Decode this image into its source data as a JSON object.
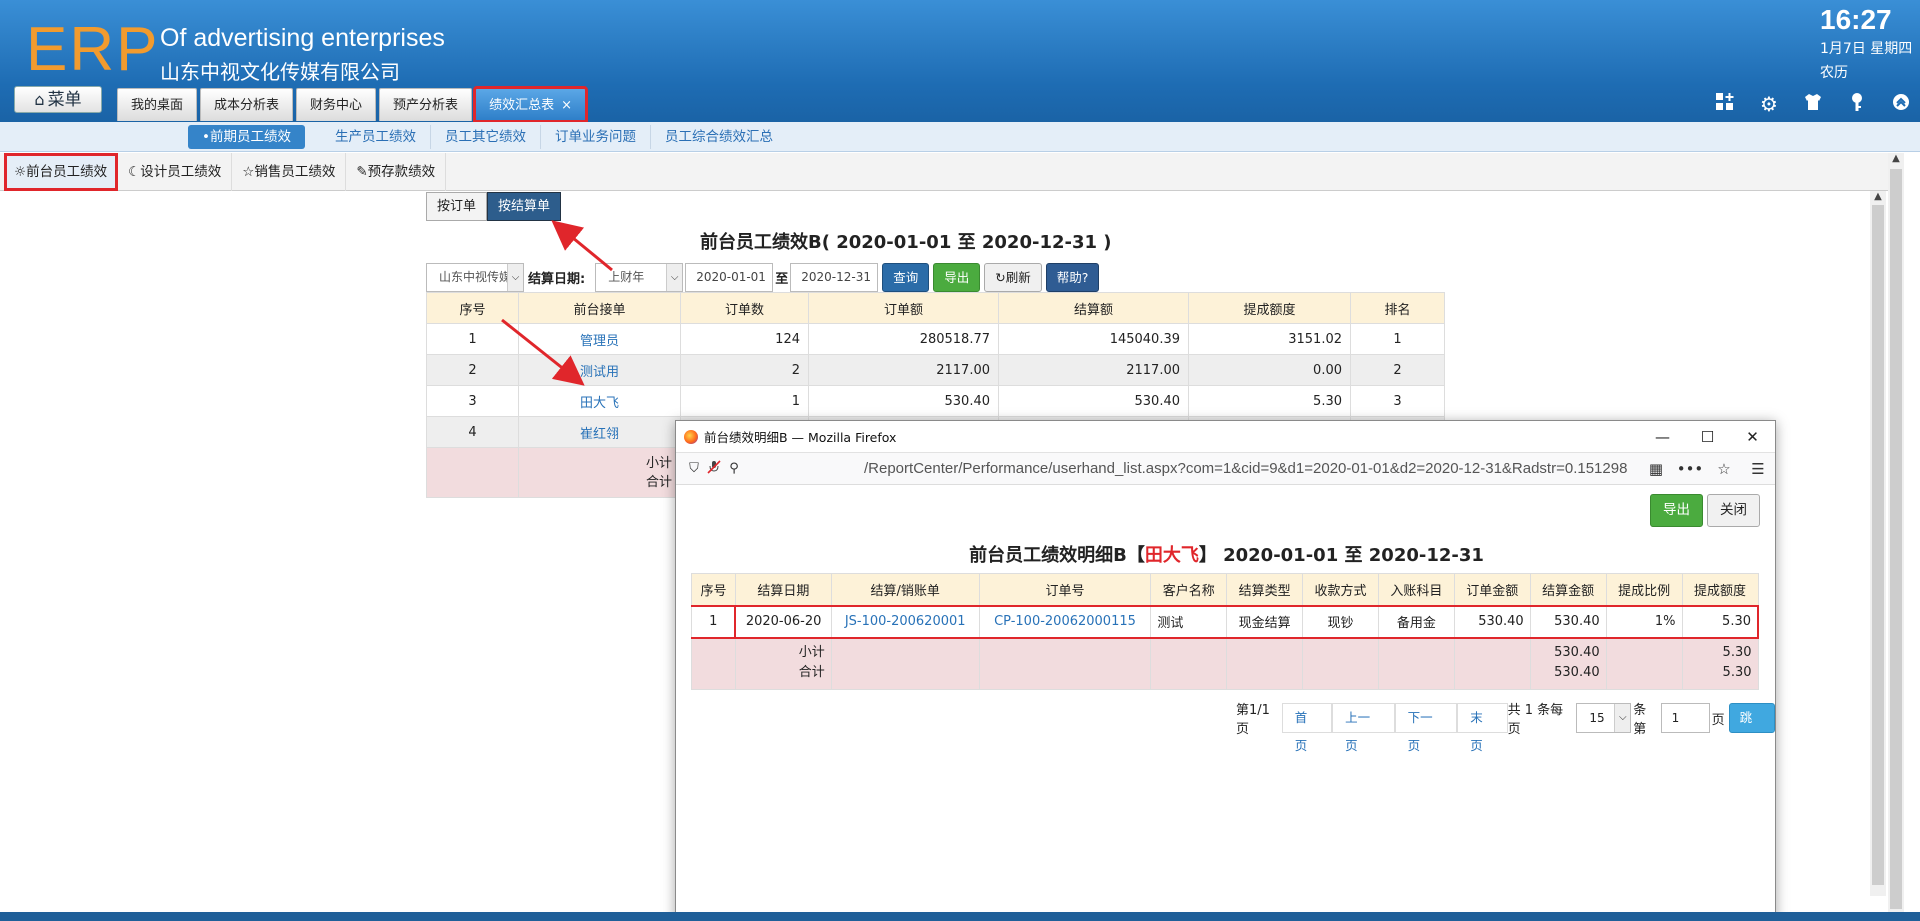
{
  "header": {
    "logo": "ERP",
    "company_en": "Of advertising enterprises",
    "company_cn": "山东中视文化传媒有限公司",
    "time": "16:27",
    "date": "1月7日 星期四",
    "lunar": "农历",
    "menu_label": "菜单",
    "tabs": [
      {
        "label": "我的桌面"
      },
      {
        "label": "成本分析表"
      },
      {
        "label": "财务中心"
      },
      {
        "label": "预产分析表"
      },
      {
        "label": "绩效汇总表",
        "close": "×"
      }
    ],
    "icons": [
      "grid-add-icon",
      "gear-icon",
      "shirt-icon",
      "key-icon",
      "chevron-up-circle-icon"
    ]
  },
  "subnav": {
    "items": [
      {
        "label": "•前期员工绩效"
      },
      {
        "label": "生产员工绩效"
      },
      {
        "label": "员工其它绩效"
      },
      {
        "label": "订单业务问题"
      },
      {
        "label": "员工综合绩效汇总"
      }
    ]
  },
  "inner_tabs": [
    {
      "icon": "☼",
      "label": "前台员工绩效"
    },
    {
      "icon": "☾",
      "label": "设计员工绩效"
    },
    {
      "icon": "☆",
      "label": "销售员工绩效"
    },
    {
      "icon": "✎",
      "label": "预存款绩效"
    }
  ],
  "mode": {
    "by_order": "按订单",
    "by_settlement": "按结算单"
  },
  "report": {
    "title": "前台员工绩效B( 2020-01-01 至 2020-12-31 )",
    "company_select": "山东中视传媒",
    "settle_label": "结算日期:",
    "period_select": "上财年",
    "date_from": "2020-01-01",
    "to_label": "至",
    "date_to": "2020-12-31",
    "btn_query": "查询",
    "btn_export": "导出",
    "btn_refresh": "刷新",
    "btn_help": "帮助?",
    "columns": [
      "序号",
      "前台接单",
      "订单数",
      "订单额",
      "结算额",
      "提成额度",
      "排名"
    ],
    "rows": [
      {
        "idx": "1",
        "name": "管理员",
        "orders": "124",
        "order_amt": "280518.77",
        "settle_amt": "145040.39",
        "commission": "3151.02",
        "rank": "1"
      },
      {
        "idx": "2",
        "name": "测试用",
        "orders": "2",
        "order_amt": "2117.00",
        "settle_amt": "2117.00",
        "commission": "0.00",
        "rank": "2"
      },
      {
        "idx": "3",
        "name": "田大飞",
        "orders": "1",
        "order_amt": "530.40",
        "settle_amt": "530.40",
        "commission": "5.30",
        "rank": "3"
      },
      {
        "idx": "4",
        "name": "崔红翎"
      }
    ],
    "subtotal": "小计",
    "total": "合计"
  },
  "popup": {
    "window_title": "前台绩效明细B — Mozilla Firefox",
    "url": "/ReportCenter/Performance/userhand_list.aspx?com=1&cid=9&d1=2020-01-01&d2=2020-12-31&Radstr=0.151298",
    "btn_export": "导出",
    "btn_close": "关闭",
    "title_prefix": "前台员工绩效明细B【",
    "title_name": "田大飞",
    "title_suffix": "】 2020-01-01 至 2020-12-31",
    "columns": [
      "序号",
      "结算日期",
      "结算/销账单",
      "订单号",
      "客户名称",
      "结算类型",
      "收款方式",
      "入账科目",
      "订单金额",
      "结算金额",
      "提成比例",
      "提成额度"
    ],
    "rows": [
      {
        "idx": "1",
        "date": "2020-06-20",
        "settle_no": "JS-100-200620001",
        "order_no": "CP-100-20062000115",
        "customer": "测试",
        "settle_type": "现金结算",
        "pay_method": "现钞",
        "account": "备用金",
        "order_amt": "530.40",
        "settle_amt": "530.40",
        "ratio": "1%",
        "commission": "5.30"
      }
    ],
    "subtotal": "小计",
    "total": "合计",
    "sub_settle": "530.40",
    "sub_commission": "5.30",
    "tot_settle": "530.40",
    "tot_commission": "5.30",
    "pager": {
      "page_info": "第1/1页",
      "first": "首页",
      "prev": "上一页",
      "next": "下一页",
      "last": "末页",
      "total_info": "共 1 条每页",
      "per_page": "15",
      "per_unit": "条第",
      "page_no": "1",
      "page_unit": "页",
      "go": "跳转"
    }
  }
}
